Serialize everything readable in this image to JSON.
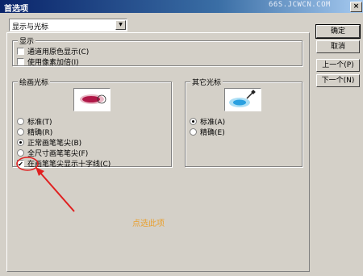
{
  "window": {
    "title": "首选项",
    "watermark": "66S.JCWCN.COM",
    "close_label": "×"
  },
  "section_select": {
    "value": "显示与光标"
  },
  "display_group": {
    "legend": "显示",
    "options": [
      {
        "label": "通道用原色显示(C)",
        "checked": false
      },
      {
        "label": "使用像素加倍(I)",
        "checked": false
      }
    ]
  },
  "painting_cursors": {
    "legend": "绘画光标",
    "options": [
      {
        "label": "标准(T)",
        "selected": false
      },
      {
        "label": "精确(R)",
        "selected": false
      },
      {
        "label": "正常画笔笔尖(B)",
        "selected": true
      },
      {
        "label": "全尺寸画笔笔尖(F)",
        "selected": false
      }
    ],
    "crosshair": {
      "label": "在画笔笔尖显示十字线(C)",
      "checked": true
    }
  },
  "other_cursors": {
    "legend": "其它光标",
    "options": [
      {
        "label": "标准(A)",
        "selected": true
      },
      {
        "label": "精确(E)",
        "selected": false
      }
    ]
  },
  "buttons": {
    "ok": "确定",
    "cancel": "取消",
    "prev": "上一个(P)",
    "next": "下一个(N)"
  },
  "annotation": {
    "text": "点选此项",
    "color": "#e8a030"
  },
  "colors": {
    "titlebar": "#0a246a",
    "dialog": "#d4d0c8",
    "annotation_mark": "#e02020"
  },
  "icons": {
    "paint_preview": "brush-stroke-icon",
    "other_preview": "eyedropper-icon"
  }
}
